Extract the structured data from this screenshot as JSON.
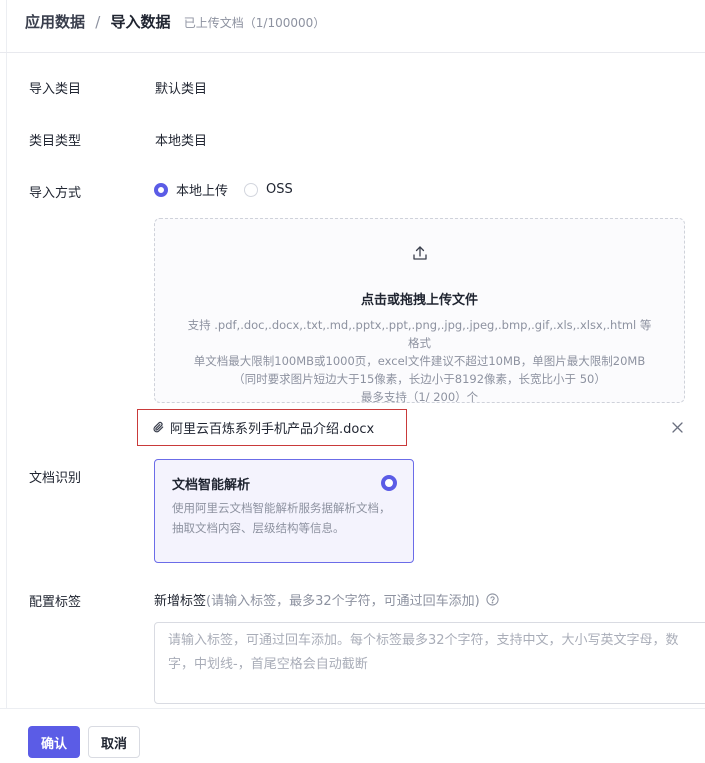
{
  "header": {
    "breadcrumb_parent": "应用数据",
    "breadcrumb_sep": "/",
    "breadcrumb_current": "导入数据",
    "uploaded_note": "已上传文档（1/100000）"
  },
  "form": {
    "import_category": {
      "label": "导入类目",
      "value": "默认类目"
    },
    "category_type": {
      "label": "类目类型",
      "value": "本地类目"
    },
    "import_method": {
      "label": "导入方式",
      "options": [
        {
          "label": "本地上传",
          "checked": true
        },
        {
          "label": "OSS",
          "checked": false
        }
      ]
    },
    "upload": {
      "title": "点击或拖拽上传文件",
      "desc_line1": "支持 .pdf,.doc,.docx,.txt,.md,.pptx,.ppt,.png,.jpg,.jpeg,.bmp,.gif,.xls,.xlsx,.html 等格式",
      "desc_line2": "单文档最大限制100MB或1000页，excel文件建议不超过10MB，单图片最大限制20MB（同时要求图片短边大于15像素，长边小于8192像素，长宽比小于 50）",
      "desc_line3": "最多支持（1/ 200）个",
      "icon": "upload-icon"
    },
    "file": {
      "name": "阿里云百炼系列手机产品介绍.docx",
      "icon": "paperclip-icon"
    },
    "doc_recognition": {
      "label": "文档识别",
      "card_title": "文档智能解析",
      "card_desc": "使用阿里云文档智能解析服务据解析文档，抽取文档内容、层级结构等信息。",
      "selected": true
    },
    "tags": {
      "label": "配置标签",
      "head_main": "新增标签",
      "head_hint": "(请输入标签，最多32个字符，可通过回车添加)",
      "placeholder": "请输入标签，可通过回车添加。每个标签最多32个字符，支持中文，大小写英文字母，数字，中划线-，首尾空格会自动截断"
    }
  },
  "footer": {
    "confirm": "确认",
    "cancel": "取消"
  },
  "colors": {
    "accent": "#5b5ce6",
    "highlight_border": "#c93a3a"
  }
}
